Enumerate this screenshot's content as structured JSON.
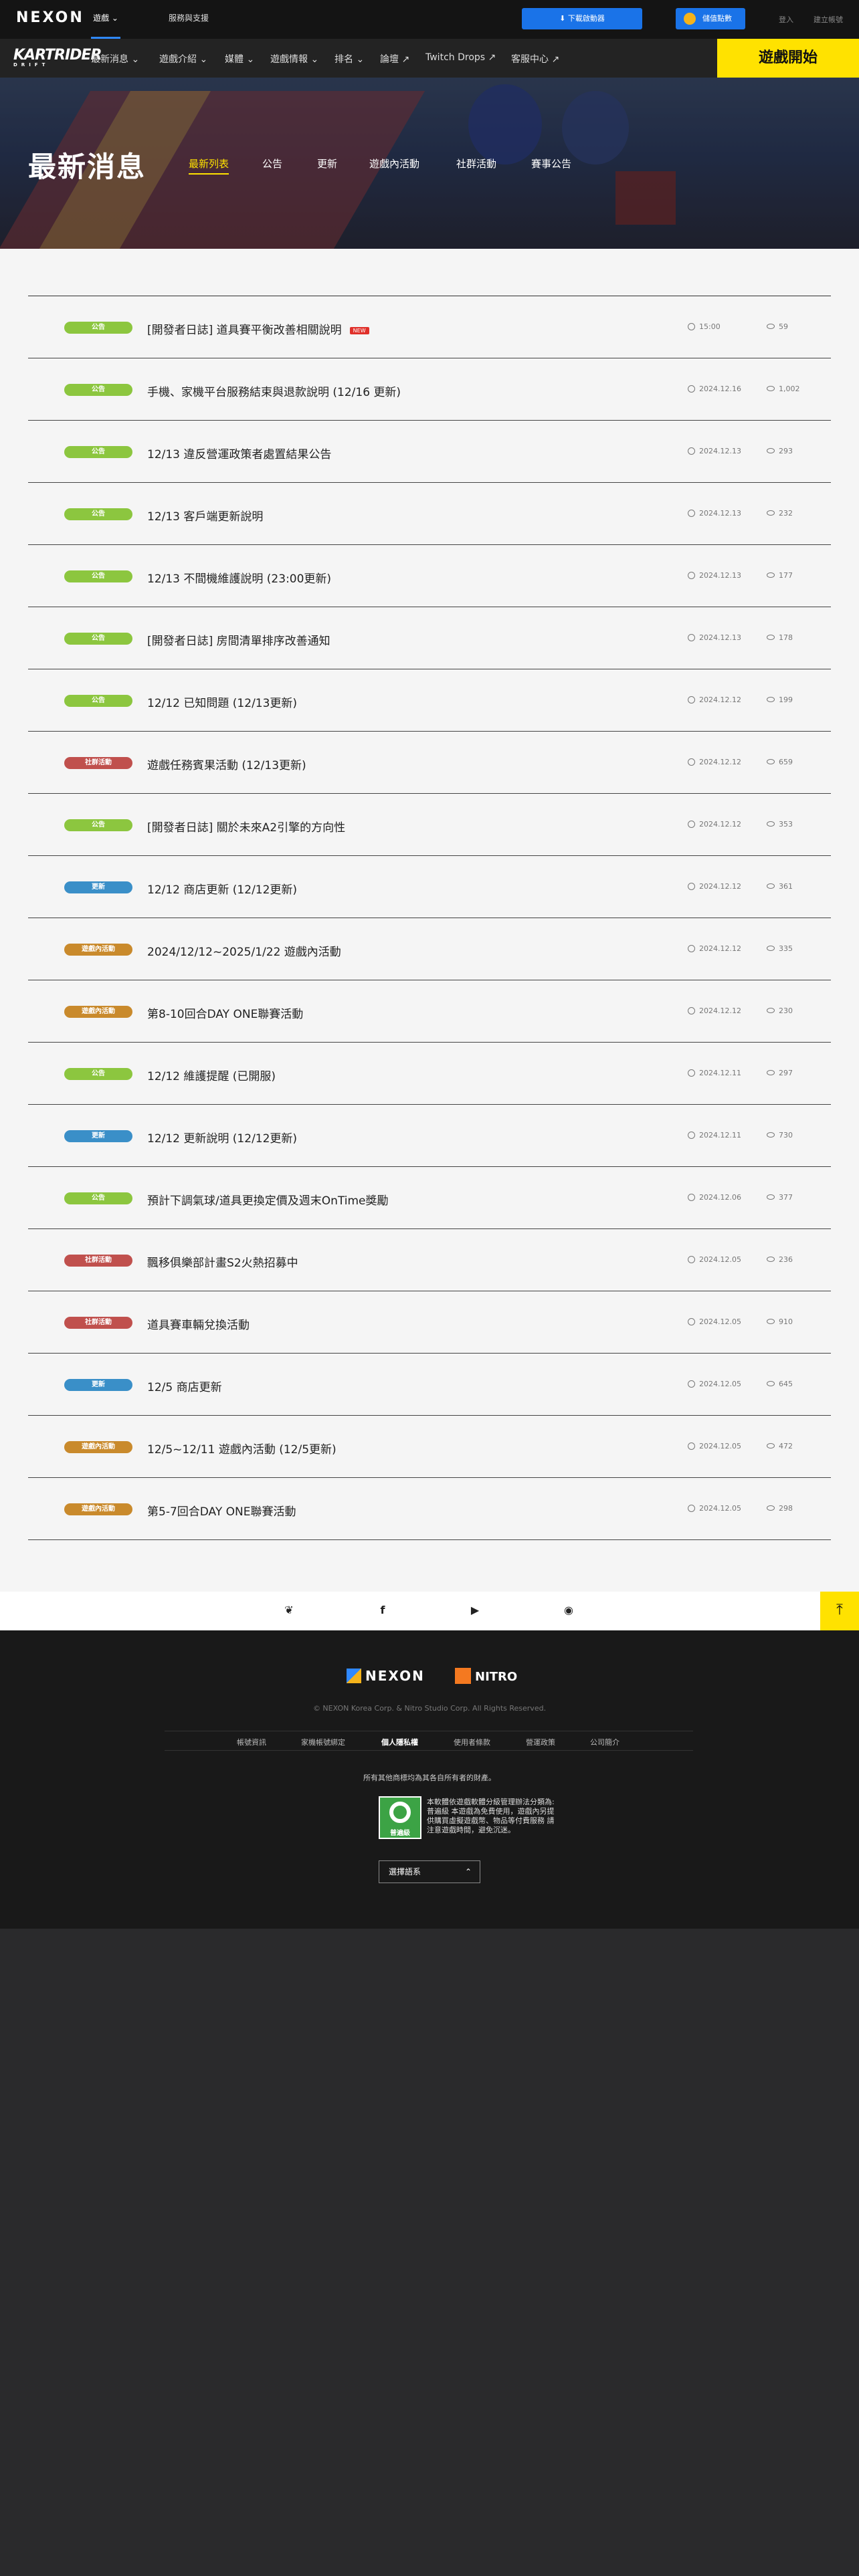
{
  "topbar": {
    "logo": "NEXON",
    "tabs": [
      {
        "label": "遊戲",
        "active": true
      },
      {
        "label": "服務與支援",
        "active": false
      }
    ],
    "download_label": "下載啟動器",
    "cash_label": "儲值點數",
    "login_label": "登入",
    "register_label": "建立帳號"
  },
  "gamenav": {
    "logo": "KARTRIDER",
    "logo_sub": "DRIFT",
    "items": [
      {
        "label": "最新消息",
        "icon": "chevron-down-icon"
      },
      {
        "label": "遊戲介紹",
        "icon": "chevron-down-icon"
      },
      {
        "label": "媒體",
        "icon": "chevron-down-icon"
      },
      {
        "label": "遊戲情報",
        "icon": "chevron-down-icon"
      },
      {
        "label": "排名",
        "icon": "chevron-down-icon"
      },
      {
        "label": "論壇",
        "icon": "external-link-icon"
      },
      {
        "label": "Twitch Drops",
        "icon": "external-link-icon"
      },
      {
        "label": "客服中心",
        "icon": "external-link-icon"
      }
    ],
    "play_label": "遊戲開始"
  },
  "hero": {
    "title": "最新消息",
    "tabs": [
      {
        "label": "最新列表",
        "active": true
      },
      {
        "label": "公告",
        "active": false
      },
      {
        "label": "更新",
        "active": false
      },
      {
        "label": "遊戲內活動",
        "active": false
      },
      {
        "label": "社群活動",
        "active": false
      },
      {
        "label": "賽事公告",
        "active": false
      }
    ]
  },
  "colors": {
    "announce": "#8cc63f",
    "community": "#c0504d",
    "update": "#3a8fc8",
    "ingame": "#c98a2c",
    "accent": "#ffe200"
  },
  "news": [
    {
      "category": "公告",
      "type": "announce",
      "title": "[開發者日誌] 道具賽平衡改善相關說明",
      "is_new": true,
      "new_label": "NEW",
      "date": "15:00",
      "views": "59"
    },
    {
      "category": "公告",
      "type": "announce",
      "title": "手機、家機平台服務結束與退款說明 (12/16 更新)",
      "is_new": false,
      "date": "2024.12.16",
      "views": "1,002"
    },
    {
      "category": "公告",
      "type": "announce",
      "title": "12/13 違反營運政策者處置結果公告",
      "is_new": false,
      "date": "2024.12.13",
      "views": "293"
    },
    {
      "category": "公告",
      "type": "announce",
      "title": "12/13 客戶端更新說明",
      "is_new": false,
      "date": "2024.12.13",
      "views": "232"
    },
    {
      "category": "公告",
      "type": "announce",
      "title": "12/13 不間機維護說明 (23:00更新)",
      "is_new": false,
      "date": "2024.12.13",
      "views": "177"
    },
    {
      "category": "公告",
      "type": "announce",
      "title": "[開發者日誌] 房間清單排序改善通知",
      "is_new": false,
      "date": "2024.12.13",
      "views": "178"
    },
    {
      "category": "公告",
      "type": "announce",
      "title": "12/12 已知問題 (12/13更新)",
      "is_new": false,
      "date": "2024.12.12",
      "views": "199"
    },
    {
      "category": "社群活動",
      "type": "community",
      "title": "遊戲任務賓果活動 (12/13更新)",
      "is_new": false,
      "date": "2024.12.12",
      "views": "659"
    },
    {
      "category": "公告",
      "type": "announce",
      "title": "[開發者日誌] 關於未來A2引擎的方向性",
      "is_new": false,
      "date": "2024.12.12",
      "views": "353"
    },
    {
      "category": "更新",
      "type": "update",
      "title": "12/12 商店更新 (12/12更新)",
      "is_new": false,
      "date": "2024.12.12",
      "views": "361"
    },
    {
      "category": "遊戲內活動",
      "type": "ingame",
      "title": "2024/12/12~2025/1/22 遊戲內活動",
      "is_new": false,
      "date": "2024.12.12",
      "views": "335"
    },
    {
      "category": "遊戲內活動",
      "type": "ingame",
      "title": "第8-10回合DAY ONE聯賽活動",
      "is_new": false,
      "date": "2024.12.12",
      "views": "230"
    },
    {
      "category": "公告",
      "type": "announce",
      "title": "12/12 維護提醒 (已開服)",
      "is_new": false,
      "date": "2024.12.11",
      "views": "297"
    },
    {
      "category": "更新",
      "type": "update",
      "title": "12/12 更新說明 (12/12更新)",
      "is_new": false,
      "date": "2024.12.11",
      "views": "730"
    },
    {
      "category": "公告",
      "type": "announce",
      "title": "預計下調氣球/道具更換定價及週末OnTime獎勵",
      "is_new": false,
      "date": "2024.12.06",
      "views": "377"
    },
    {
      "category": "社群活動",
      "type": "community",
      "title": "飄移俱樂部計畫S2火熱招募中",
      "is_new": false,
      "date": "2024.12.05",
      "views": "236"
    },
    {
      "category": "社群活動",
      "type": "community",
      "title": "道具賽車輛兌換活動",
      "is_new": false,
      "date": "2024.12.05",
      "views": "910"
    },
    {
      "category": "更新",
      "type": "update",
      "title": "12/5 商店更新",
      "is_new": false,
      "date": "2024.12.05",
      "views": "645"
    },
    {
      "category": "遊戲內活動",
      "type": "ingame",
      "title": "12/5~12/11 遊戲內活動 (12/5更新)",
      "is_new": false,
      "date": "2024.12.05",
      "views": "472"
    },
    {
      "category": "遊戲內活動",
      "type": "ingame",
      "title": "第5-7回合DAY ONE聯賽活動",
      "is_new": false,
      "date": "2024.12.05",
      "views": "298"
    }
  ],
  "social": {
    "icons": [
      "bird-icon",
      "facebook-icon",
      "youtube-icon",
      "discord-icon"
    ],
    "top_icon": "arrow-up-icon"
  },
  "footer": {
    "nexon_logo": "NEXON",
    "nitro_logo": "NITRO",
    "copyright": "© NEXON Korea Corp. & Nitro Studio Corp. All Rights Reserved.",
    "links": [
      {
        "label": "帳號資訊",
        "bold": false
      },
      {
        "label": "家機帳號綁定",
        "bold": false
      },
      {
        "label": "個人隱私權",
        "bold": true
      },
      {
        "label": "使用者條款",
        "bold": false
      },
      {
        "label": "營運政策",
        "bold": false
      },
      {
        "label": "公司簡介",
        "bold": false
      }
    ],
    "trademark": "所有其他商標均為其各自所有者的財產。",
    "rating_label": "普遍級",
    "rating_text": "本軟體依遊戲軟體分級管理辦法分類為:普遍級 本遊戲為免費使用，遊戲內另提供購買虛擬遊戲幣、物品等付費服務 請注意遊戲時間，避免沉迷。",
    "language_label": "選擇語系"
  }
}
